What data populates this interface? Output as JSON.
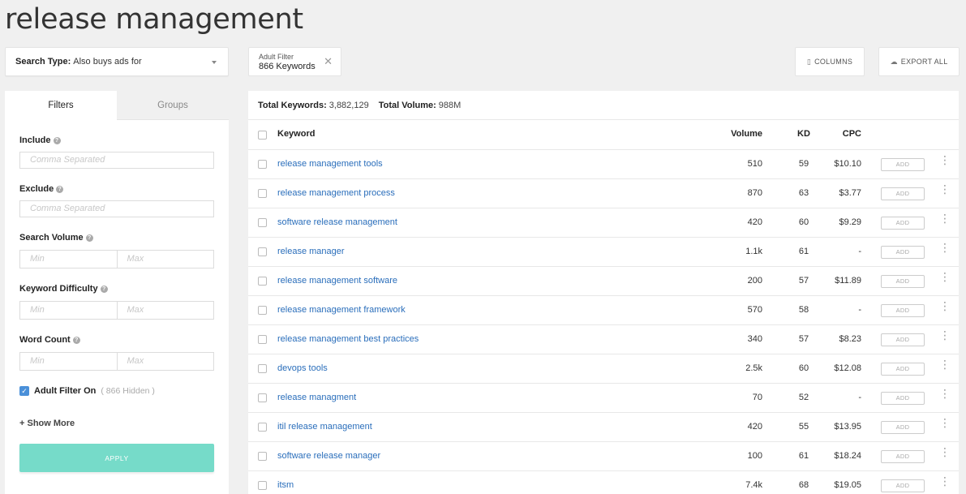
{
  "page_title": "release management",
  "search_type": {
    "label": "Search Type:",
    "value": "Also buys ads for"
  },
  "adult_chip": {
    "line1": "Adult Filter",
    "line2": "866 Keywords",
    "close": "✕"
  },
  "columns_button": "COLUMNS",
  "export_button": "EXPORT ALL",
  "sidebar": {
    "tabs": [
      "Filters",
      "Groups"
    ],
    "include": {
      "label": "Include",
      "placeholder": "Comma Separated"
    },
    "exclude": {
      "label": "Exclude",
      "placeholder": "Comma Separated"
    },
    "search_volume": {
      "label": "Search Volume",
      "min": "Min",
      "max": "Max"
    },
    "keyword_difficulty": {
      "label": "Keyword Difficulty",
      "min": "Min",
      "max": "Max"
    },
    "word_count": {
      "label": "Word Count",
      "min": "Min",
      "max": "Max"
    },
    "adult_filter": {
      "label": "Adult Filter On",
      "hidden": "( 866 Hidden )"
    },
    "show_more": "+ Show More",
    "apply": "APPLY"
  },
  "totals": {
    "keywords_label": "Total Keywords:",
    "keywords_value": "3,882,129",
    "volume_label": "Total Volume:",
    "volume_value": "988M"
  },
  "table": {
    "headers": {
      "keyword": "Keyword",
      "volume": "Volume",
      "kd": "KD",
      "cpc": "CPC"
    },
    "add_label": "ADD",
    "rows": [
      {
        "keyword": "release management tools",
        "volume": "510",
        "kd": "59",
        "cpc": "$10.10"
      },
      {
        "keyword": "release management process",
        "volume": "870",
        "kd": "63",
        "cpc": "$3.77"
      },
      {
        "keyword": "software release management",
        "volume": "420",
        "kd": "60",
        "cpc": "$9.29"
      },
      {
        "keyword": "release manager",
        "volume": "1.1k",
        "kd": "61",
        "cpc": "-"
      },
      {
        "keyword": "release management software",
        "volume": "200",
        "kd": "57",
        "cpc": "$11.89"
      },
      {
        "keyword": "release management framework",
        "volume": "570",
        "kd": "58",
        "cpc": "-"
      },
      {
        "keyword": "release management best practices",
        "volume": "340",
        "kd": "57",
        "cpc": "$8.23"
      },
      {
        "keyword": "devops tools",
        "volume": "2.5k",
        "kd": "60",
        "cpc": "$12.08"
      },
      {
        "keyword": "release managment",
        "volume": "70",
        "kd": "52",
        "cpc": "-"
      },
      {
        "keyword": "itil release management",
        "volume": "420",
        "kd": "55",
        "cpc": "$13.95"
      },
      {
        "keyword": "software release manager",
        "volume": "100",
        "kd": "61",
        "cpc": "$18.24"
      },
      {
        "keyword": "itsm",
        "volume": "7.4k",
        "kd": "68",
        "cpc": "$19.05"
      }
    ]
  }
}
